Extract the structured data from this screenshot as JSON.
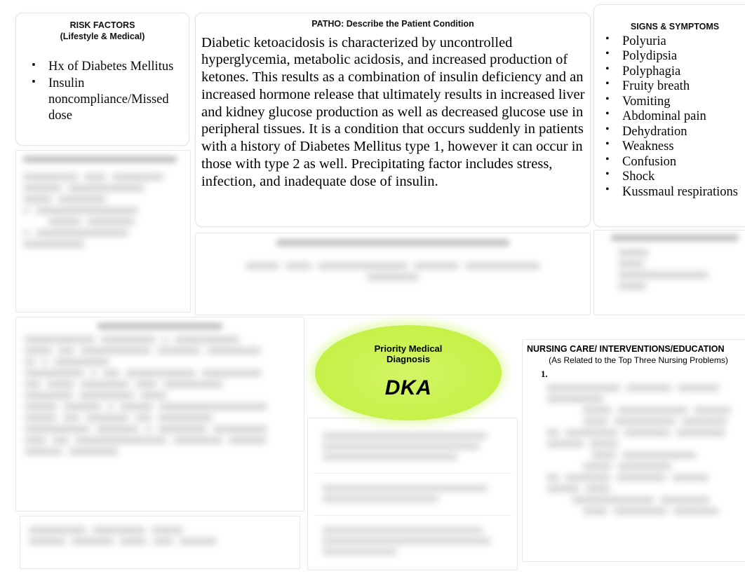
{
  "document": {
    "type": "nursing-concept-map",
    "background_color": "#ffffff"
  },
  "risk_factors": {
    "title_line1": "RISK FACTORS",
    "title_line2": "(Lifestyle & Medical)",
    "items": [
      "Hx of Diabetes Mellitus",
      "Insulin noncompliance/Missed dose"
    ]
  },
  "patho": {
    "title": "PATHO:  Describe the Patient Condition",
    "body": "Diabetic ketoacidosis is characterized by uncontrolled hyperglycemia, metabolic acidosis, and increased production of ketones. This results as a combination of insulin deficiency and an increased hormone release that ultimately results in increased liver and kidney glucose production as well as decreased glucose use in peripheral tissues. It is a condition that occurs suddenly in patients with a history of Diabetes Mellitus type 1, however it can occur in those with type 2 as well. Precipitating factor includes stress, infection, and inadequate dose of insulin."
  },
  "signs_symptoms": {
    "title": "SIGNS & SYMPTOMS",
    "items": [
      "Polyuria",
      "Polydipsia",
      "Polyphagia",
      "Fruity breath",
      "Vomiting",
      "Abdominal pain",
      "Dehydration",
      "Weakness",
      "Confusion",
      "Shock",
      "Kussmaul respirations"
    ]
  },
  "priority_medical_diagnosis": {
    "title_line1": "Priority Medical",
    "title_line2": "Diagnosis",
    "value": "DKA",
    "fill_color": "#c9f24e"
  },
  "nursing_care": {
    "title": "NURSING CARE/ INTERVENTIONS/EDUCATION",
    "subtitle": "(As Related to the Top Three Nursing Problems)",
    "first_item_number": "1."
  },
  "redacted_sections": {
    "note": "These regions are blurred/illegible in the source image",
    "labs_panel": {
      "header_lines": 1,
      "body_lines": 7
    },
    "diagnostic_panel": {
      "header_lines": 1,
      "body_lines": 2
    },
    "medications_panel": {
      "header_lines": 1,
      "body_lines": 4
    },
    "nursing_problems_panel": {
      "header_lines": 1,
      "body_lines": 11
    },
    "nursing_problems_sub_panel": {
      "body_lines": 2
    },
    "goals_rows": 3,
    "nursing_care_body_lines": 12
  }
}
